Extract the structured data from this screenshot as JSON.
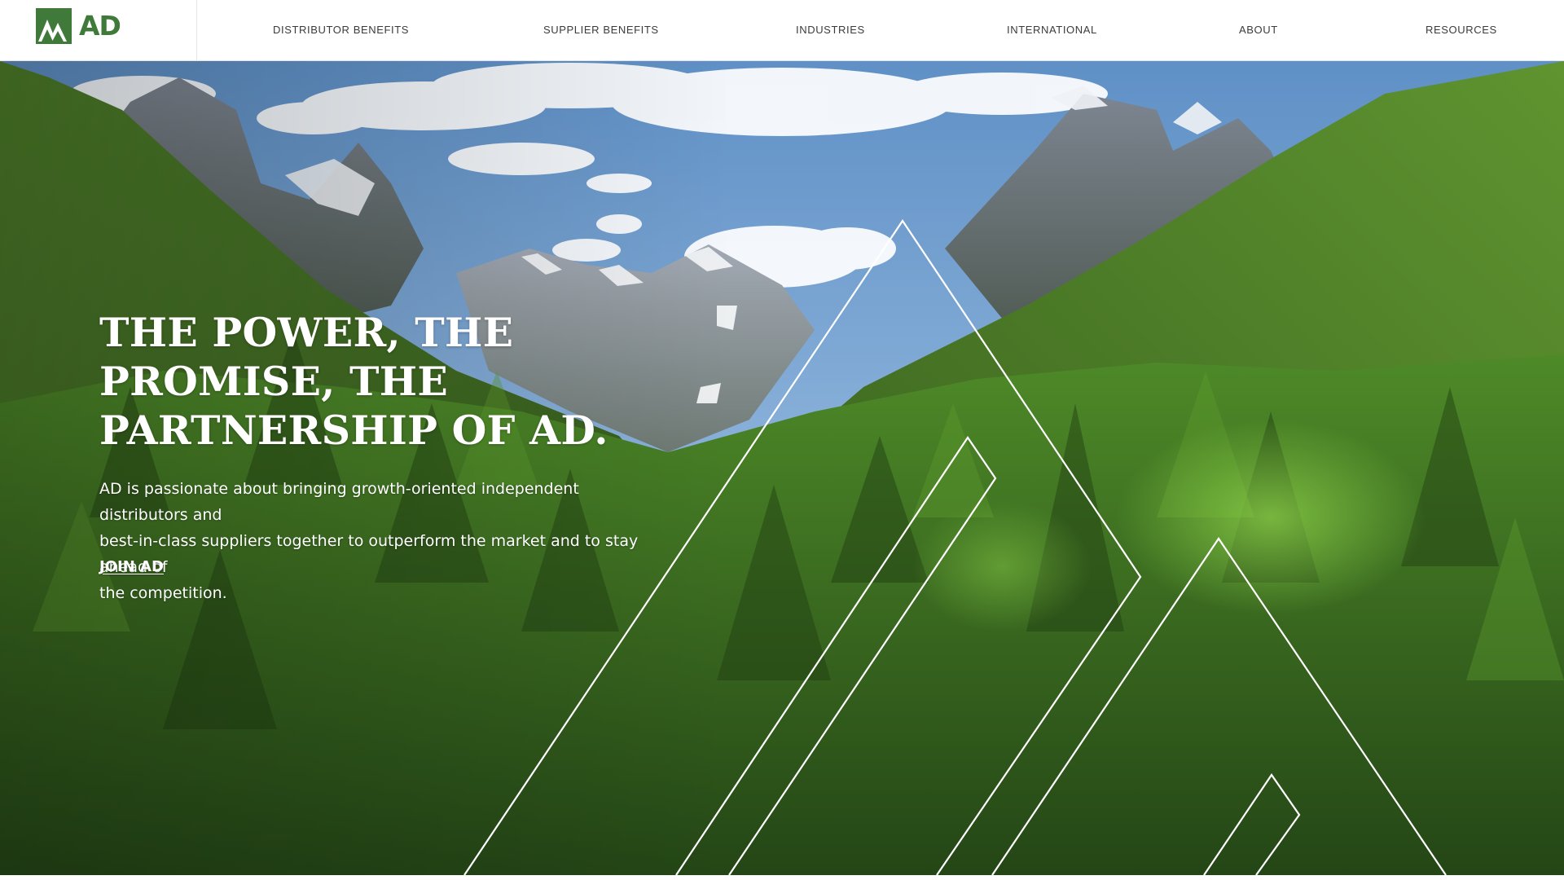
{
  "brand": {
    "name": "AD",
    "logo_icon": "mountain-peaks-logo-icon",
    "color": "#3f7a3a"
  },
  "nav": {
    "items": [
      {
        "label": "DISTRIBUTOR BENEFITS"
      },
      {
        "label": "SUPPLIER BENEFITS"
      },
      {
        "label": "INDUSTRIES"
      },
      {
        "label": "INTERNATIONAL"
      },
      {
        "label": "ABOUT"
      },
      {
        "label": "RESOURCES"
      }
    ]
  },
  "hero": {
    "title": "THE POWER, THE\nPROMISE, THE\nPARTNERSHIP OF AD.",
    "description": "AD is passionate about bringing growth-oriented independent distributors and\nbest-in-class suppliers together to outperform the market and to stay ahead of\nthe competition.",
    "cta_label": "JOIN AD",
    "text_color": "#ffffff",
    "image": "forested-mountain-valley"
  }
}
